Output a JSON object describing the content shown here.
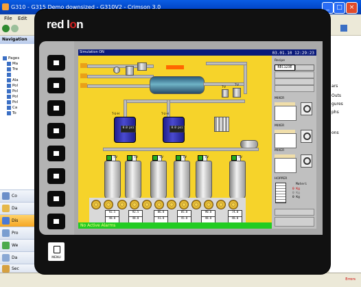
{
  "window": {
    "title": "G310 - G315 Demo downsized - G310V2 - Crimson 3.0"
  },
  "menubar": [
    "File",
    "Edit"
  ],
  "navigation": {
    "title": "Navigation",
    "tree": [
      "Pages",
      "Ma",
      "Tre",
      "",
      "Ala",
      "Pol",
      "Pol",
      "Pol",
      "Pol",
      "Ca",
      "To"
    ],
    "categories": [
      "Co",
      "Da",
      "Dis",
      "Pro",
      "We",
      "Da",
      "Sec"
    ]
  },
  "right_panel": [
    "ars",
    "Outs",
    "gures",
    "phs",
    "ons"
  ],
  "status": {
    "errors": "Errors"
  },
  "device": {
    "brand_prefix": "red l",
    "brand_o": "o",
    "brand_suffix": "n",
    "menu_label": "MENU"
  },
  "hmi": {
    "status_text": "Simulation ON",
    "clock": "03.01.10 12:29:23",
    "recipe_label": "Recipe",
    "recipe_value": "REC123E",
    "mixers": [
      "MIXER",
      "MIXER",
      "MIXER"
    ],
    "hopper_label": "HOPPER",
    "hopper_material": "Materi",
    "hopper_values": [
      "0 Kg",
      "0 Kg",
      "0 Kg"
    ],
    "alarm_text": "No Active Alarms",
    "tv_label": "T-V",
    "tuh_label": "T-U-H",
    "pressure_values": [
      "0.0 psi",
      "0.0 psi"
    ],
    "readouts_top": [
      "92.5",
      "92.5",
      "86.8",
      "85.0",
      "90.0",
      "74.0"
    ],
    "readouts_bottom": [
      "48.0",
      "48.0",
      "41.0",
      "45.0",
      "48.0",
      "48.0"
    ]
  },
  "colors": {
    "hmi_bg": "#f6d32a",
    "alarm_bar": "#22cc22",
    "title_bar": "#0a1a7a",
    "brand_accent": "#d21f1f"
  }
}
